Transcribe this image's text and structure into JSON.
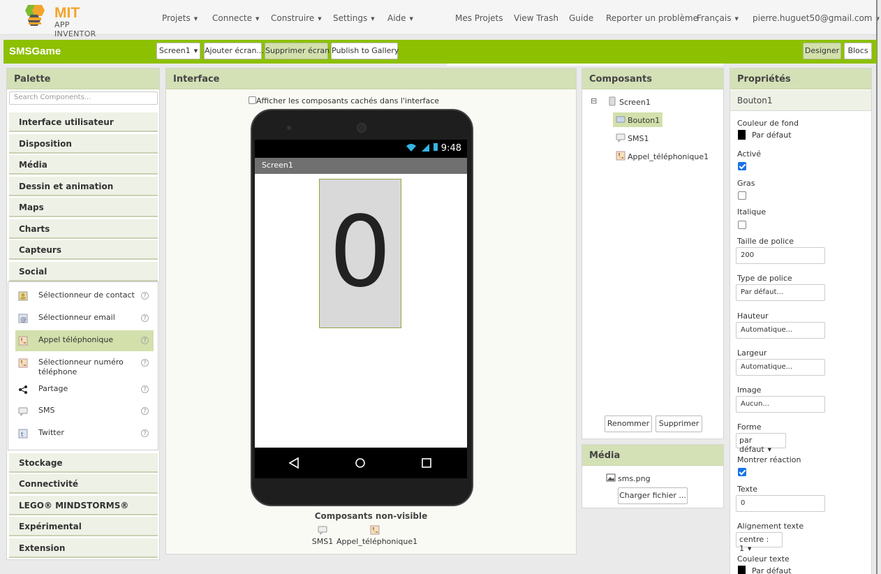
{
  "nav": {
    "logo_mit": "MIT",
    "logo_ai": "APP INVENTOR",
    "menus": [
      "Projets",
      "Connecte",
      "Construire",
      "Settings",
      "Aide"
    ],
    "links": [
      "Mes Projets",
      "View Trash",
      "Guide",
      "Reporter un problème"
    ],
    "language": "Français",
    "user": "pierre.huguet50@gmail.com"
  },
  "project": {
    "name": "SMSGame",
    "screen_select": "Screen1",
    "add_screen": "Ajouter écran...",
    "remove_screen": "Supprimer écran",
    "publish": "Publish to Gallery",
    "designer": "Designer",
    "blocks": "Blocs"
  },
  "palette": {
    "title": "Palette",
    "search_placeholder": "Search Components...",
    "categories_top": [
      "Interface utilisateur",
      "Disposition",
      "Média",
      "Dessin et animation",
      "Maps",
      "Charts",
      "Capteurs",
      "Social"
    ],
    "social_items": [
      {
        "label": "Sélectionneur de contact",
        "icon": "contact-picker-icon"
      },
      {
        "label": "Sélectionneur email",
        "icon": "email-picker-icon"
      },
      {
        "label": "Appel téléphonique",
        "icon": "phone-call-icon"
      },
      {
        "label": "Sélectionneur numéro téléphone",
        "icon": "phone-number-picker-icon"
      },
      {
        "label": "Partage",
        "icon": "share-icon"
      },
      {
        "label": "SMS",
        "icon": "sms-icon"
      },
      {
        "label": "Twitter",
        "icon": "twitter-icon"
      }
    ],
    "help_glyph": "?",
    "categories_bottom": [
      "Stockage",
      "Connectivité",
      "LEGO® MINDSTORMS®",
      "Expérimental",
      "Extension"
    ]
  },
  "viewer": {
    "title": "Interface",
    "show_hidden": "Afficher les composants cachés dans l'interface",
    "time": "9:48",
    "screen_title": "Screen1",
    "button_text": "0",
    "nonvisible_title": "Composants non-visible",
    "nonvisible": [
      "SMS1",
      "Appel_téléphonique1"
    ]
  },
  "components": {
    "title": "Composants",
    "collapse": "⊟",
    "root": "Screen1",
    "children": [
      "Bouton1",
      "SMS1",
      "Appel_téléphonique1"
    ],
    "rename": "Renommer",
    "delete": "Supprimer"
  },
  "media": {
    "title": "Média",
    "file": "sms.png",
    "upload": "Charger fichier ..."
  },
  "properties": {
    "title": "Propriétés",
    "component": "Bouton1",
    "bg_label": "Couleur de fond",
    "bg_value": "Par défaut",
    "enabled_label": "Activé",
    "enabled": true,
    "bold_label": "Gras",
    "bold": false,
    "italic_label": "Italique",
    "italic": false,
    "fontsize_label": "Taille de police",
    "fontsize": "200",
    "fonttype_label": "Type de police",
    "fonttype": "Par défaut...",
    "height_label": "Hauteur",
    "height": "Automatique...",
    "width_label": "Largeur",
    "width": "Automatique...",
    "image_label": "Image",
    "image": "Aucun...",
    "shape_label": "Forme",
    "shape": "par défaut",
    "feedback_label": "Montrer réaction",
    "feedback": true,
    "text_label": "Texte",
    "text": "0",
    "align_label": "Alignement texte",
    "align": "centre : 1",
    "textcolor_label": "Couleur texte",
    "textcolor": "Par défaut"
  },
  "colors": {
    "accent": "#8dc001",
    "header": "#d4e0b6",
    "selected": "#d3e0ac"
  }
}
